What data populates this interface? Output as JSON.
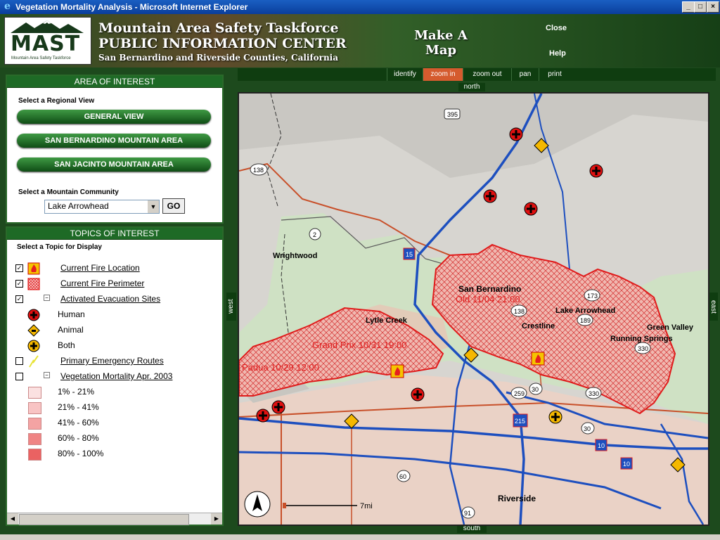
{
  "window": {
    "title": "Vegetation Mortality Analysis - Microsoft Internet Explorer",
    "controls": [
      "_",
      "□",
      "×"
    ]
  },
  "banner": {
    "logo_text": "MAST",
    "logo_subtext": "Mountain Area Safety Taskforce",
    "org_line1": "Mountain Area Safety Taskforce",
    "org_line2": "PUBLIC INFORMATION CENTER",
    "org_line3": "San Bernardino and Riverside Counties, California",
    "make_map": "Make A Map",
    "close": "Close",
    "help": "Help"
  },
  "area_of_interest": {
    "heading": "AREA OF INTEREST",
    "regional_label": "Select a Regional View",
    "buttons": [
      "GENERAL VIEW",
      "SAN BERNARDINO MOUNTAIN AREA",
      "SAN JACINTO MOUNTAIN AREA"
    ],
    "community_label": "Select a Mountain Community",
    "community_selected": "Lake Arrowhead",
    "go": "GO"
  },
  "topics": {
    "heading": "TOPICS OF INTEREST",
    "select_label": "Select a Topic for Display",
    "items": [
      {
        "label": "Current Fire Location",
        "checked": true
      },
      {
        "label": "Current Fire Perimeter",
        "checked": true
      },
      {
        "label": "Activated Evacuation Sites",
        "checked": true
      },
      {
        "label": "Primary Emergency Routes",
        "checked": false
      },
      {
        "label": "Vegetation Mortality Apr. 2003",
        "checked": false
      }
    ],
    "evac_sub": [
      "Human",
      "Animal",
      "Both"
    ],
    "mortality_legend": [
      {
        "label": "1% - 21%",
        "color": "#fbe1e1"
      },
      {
        "label": "21% - 41%",
        "color": "#f8c4c4"
      },
      {
        "label": "41% - 60%",
        "color": "#f4a3a3"
      },
      {
        "label": "60% - 80%",
        "color": "#ef8484"
      },
      {
        "label": "80% - 100%",
        "color": "#ea6262"
      }
    ]
  },
  "toolbar": {
    "tools": [
      "identify",
      "zoom in",
      "zoom out",
      "pan",
      "print"
    ],
    "active": "zoom in"
  },
  "nav": {
    "north": "north",
    "south": "south",
    "west": "west",
    "east": "east"
  },
  "map": {
    "places": [
      "Wrightwood",
      "San Bernardino",
      "Lake Arrowhead",
      "Crestline",
      "Green Valley",
      "Running Springs",
      "Lytle Creek",
      "Riverside"
    ],
    "fires": [
      "Old 11/04 21:00",
      "Grand Prix 10/31 19:00",
      "Padua 10/29 12:00"
    ],
    "shields": [
      "395",
      "138",
      "2",
      "15",
      "173",
      "138",
      "189",
      "330",
      "259",
      "30",
      "330",
      "215",
      "30",
      "10",
      "10",
      "60",
      "91"
    ],
    "scale": "7mi",
    "colors": {
      "fire": "#e01b1b",
      "route": "#1d4fbf",
      "road": "#c8502a",
      "evac": "#e01010"
    }
  }
}
